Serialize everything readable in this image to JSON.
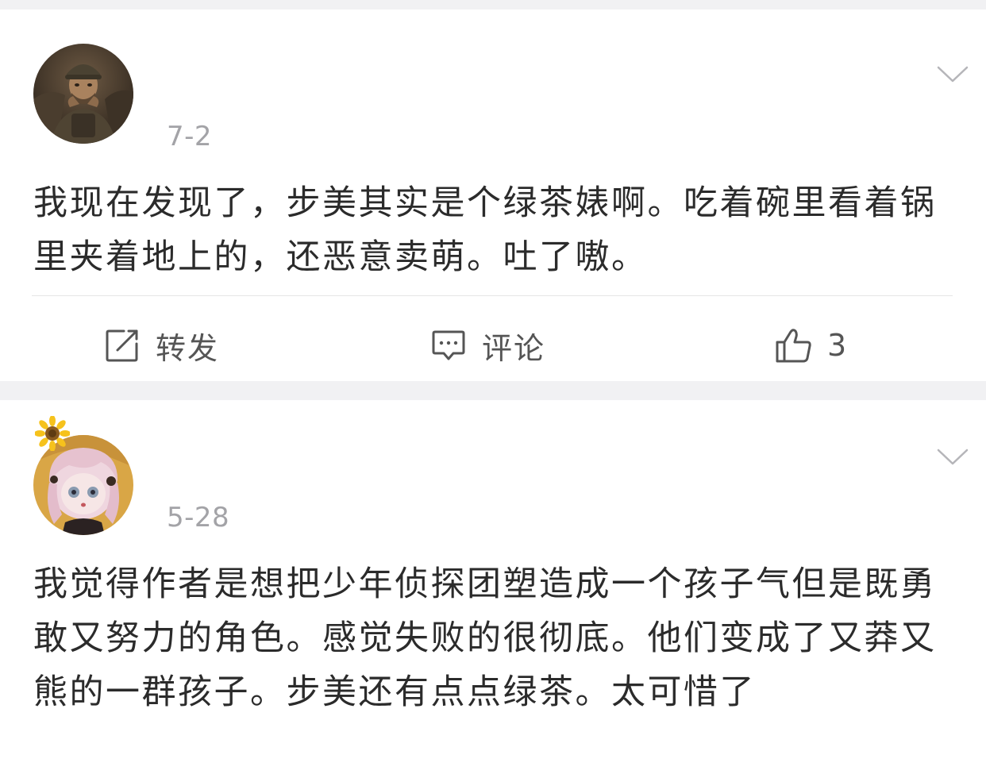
{
  "comments": [
    {
      "date": "7-2",
      "body": "我现在发现了，步美其实是个绿茶婊啊。吃着碗里看着锅里夹着地上的，还恶意卖萌。吐了嗷。",
      "actions": {
        "repost_label": "转发",
        "comment_label": "评论",
        "like_count": "3"
      }
    },
    {
      "date": "5-28",
      "body": "我觉得作者是想把少年侦探团塑造成一个孩子气但是既勇敢又努力的角色。感觉失败的很彻底。他们变成了又莽又熊的一群孩子。步美还有点点绿茶。太可惜了"
    }
  ],
  "icons": {
    "repost": "repost-icon",
    "comment": "comment-icon",
    "like": "thumbs-up-icon",
    "expand": "chevron-down-icon",
    "badge": "sunflower-icon"
  },
  "colors": {
    "text": "#2b2b2b",
    "meta": "#a3a3a7",
    "separator": "#f1f1f3",
    "icon": "#555555"
  }
}
